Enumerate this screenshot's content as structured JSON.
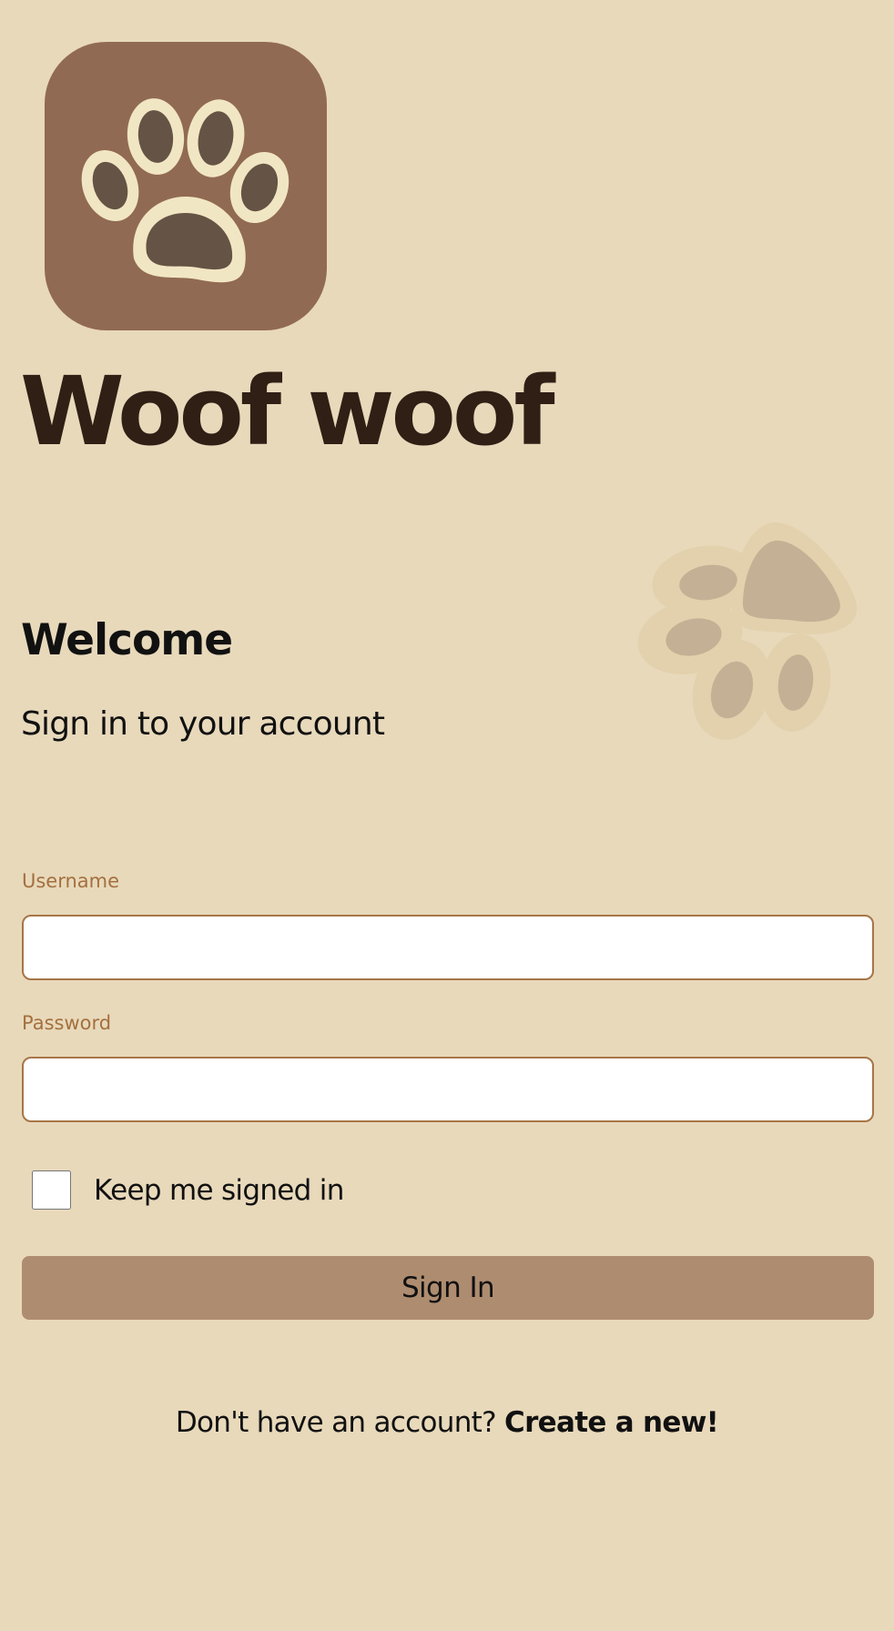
{
  "app": {
    "title": "Woof woof",
    "logo_icon": "paw-icon"
  },
  "header": {
    "welcome": "Welcome",
    "subtitle": "Sign in to your account"
  },
  "form": {
    "username_label": "Username",
    "username_value": "",
    "password_label": "Password",
    "password_value": "",
    "remember_label": "Keep me signed in",
    "remember_checked": false,
    "submit_label": "Sign In"
  },
  "footer": {
    "prompt": "Don't have an account?",
    "link_label": "Create a new!"
  },
  "colors": {
    "background": "#e8d9bb",
    "icon_tile": "#916a53",
    "paw_outline": "#f1e6c3",
    "paw_fill": "#655345",
    "label_accent": "#a4703f",
    "input_border": "#a77547",
    "button": "#ae8c70",
    "title_text": "#2f1f15"
  }
}
